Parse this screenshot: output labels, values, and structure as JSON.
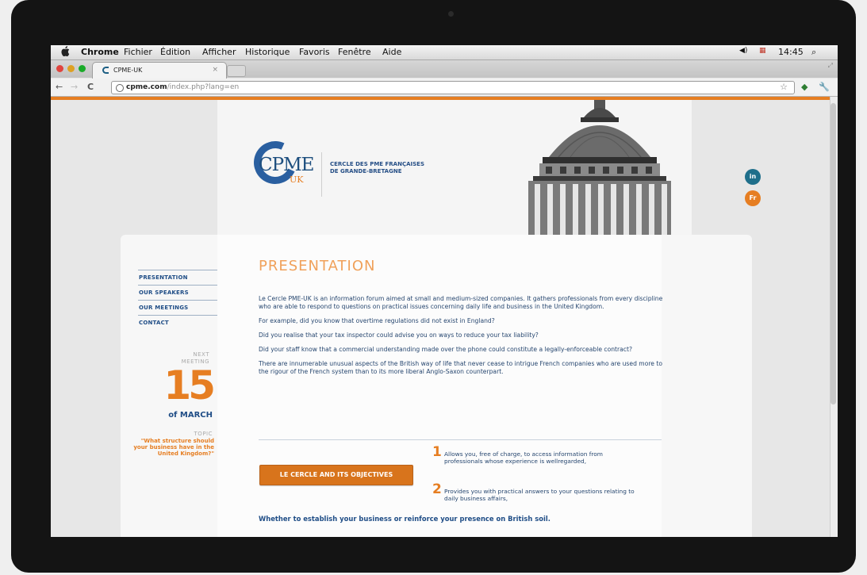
{
  "menubar": {
    "app": "Chrome",
    "items": [
      "Fichier",
      "Édition",
      "Afficher",
      "Historique",
      "Favoris",
      "Fenêtre",
      "Aide"
    ],
    "clock": "14:45"
  },
  "browser": {
    "tab_title": "CPME-UK",
    "tab_close": "×",
    "url_host": "cpme.com",
    "url_path": "/index.php?lang=en"
  },
  "site": {
    "logo_main": "CPME",
    "logo_sub": "UK",
    "tagline_1": "CERCLE DES PME FRANÇAISES",
    "tagline_2": "DE GRANDE-BRETAGNE",
    "social_linkedin": "in",
    "social_fr": "Fr",
    "nav": [
      "PRESENTATION",
      "OUR SPEAKERS",
      "OUR MEETINGS",
      "CONTACT"
    ],
    "next_meeting_label_1": "NEXT",
    "next_meeting_label_2": "MEETING",
    "meeting_day": "15",
    "meeting_month": "of MARCH",
    "topic_label": "TOPIC",
    "topic_text": "\"What structure should your business have in the United Kingdom?\"",
    "title": "PRESENTATION",
    "paragraphs": [
      "Le Cercle PME-UK is an information forum aimed at small and medium-sized companies. It gathers professionals from every discipline who are able to respond to questions on practical issues concerning daily life and business in the United Kingdom.",
      "For example, did you know that overtime regulations did not exist in England?",
      "Did you realise that your tax inspector could advise you on ways to reduce your tax liability?",
      "Did your staff know that a commercial understanding made over the phone could constitute a legally-enforceable contract?",
      "There are innumerable unusual aspects of the British way of life that never cease to intrigue French companies who are used more to the rigour of the French system than to its more liberal Anglo-Saxon counterpart."
    ],
    "objectives_button": "LE CERCLE AND ITS OBJECTIVES",
    "objectives": [
      {
        "num": "1",
        "text": "Allows you, free of charge, to access information from professionals whose experience is wellregarded,"
      },
      {
        "num": "2",
        "text": "Provides you with practical answers to your questions relating to daily business affairs,"
      }
    ],
    "closing": "Whether to establish your business or reinforce your presence on British soil."
  },
  "colors": {
    "accent": "#e67e22",
    "brand_blue": "#1f4d86"
  }
}
